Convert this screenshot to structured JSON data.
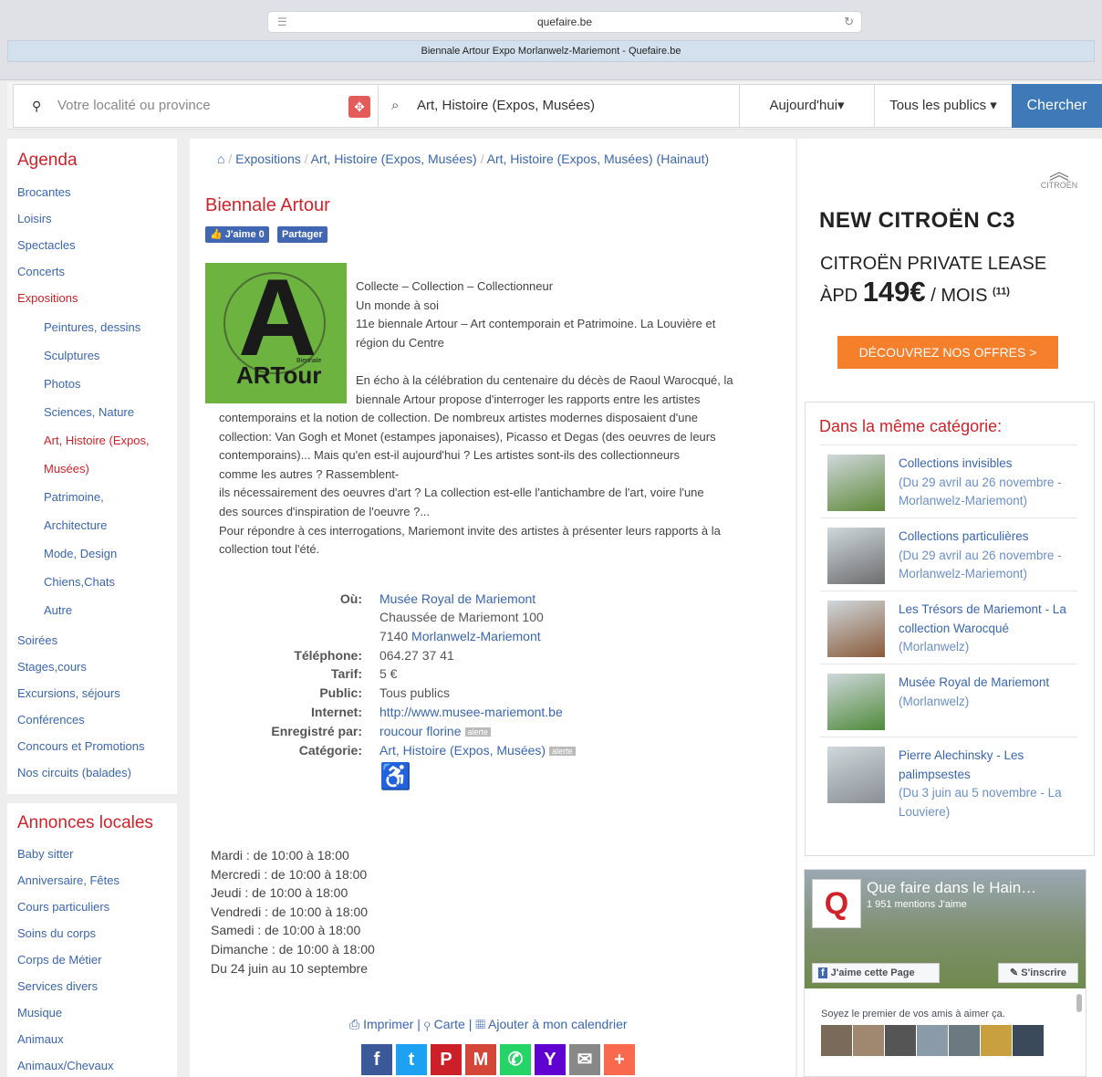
{
  "browser": {
    "url": "quefaire.be",
    "tab_title": "Biennale Artour Expo Morlanwelz-Mariemont - Quefaire.be"
  },
  "searchbar": {
    "location_placeholder": "Votre localité ou province",
    "category_value": "Art, Histoire (Expos, Musées)",
    "when_value": "Aujourd'hui▾",
    "public_value": "Tous les publics ▾",
    "search_label": "Chercher"
  },
  "sidebar": {
    "agenda_heading": "Agenda",
    "agenda_items": [
      "Brocantes",
      "Loisirs",
      "Spectacles",
      "Concerts",
      "Expositions",
      "Peintures, dessins",
      "Sculptures",
      "Photos",
      "Sciences, Nature",
      "Art, Histoire (Expos,",
      "Musées)",
      "Patrimoine,",
      "Architecture",
      "Mode, Design",
      "Chiens,Chats",
      "Autre",
      "Soirées",
      "Stages,cours",
      "Excursions, séjours",
      "Conférences",
      "Concours et Promotions",
      "Nos circuits (balades)"
    ],
    "annonces_heading": "Annonces locales",
    "annonces_items": [
      "Baby sitter",
      "Anniversaire, Fêtes",
      "Cours particuliers",
      "Soins du corps",
      "Corps de Métier",
      "Services divers",
      "Musique",
      "Animaux",
      "Animaux/Chevaux"
    ]
  },
  "breadcrumb": [
    "Expositions",
    "Art, Histoire (Expos, Musées)",
    "Art, Histoire (Expos, Musées) (Hainaut)"
  ],
  "event": {
    "title": "Biennale Artour",
    "like_label": "J'aime 0",
    "share_label": "Partager",
    "poster_text": "ARTour",
    "poster_small": "Biennale",
    "body_lines": [
      "Collecte – Collection – Collectionneur",
      "Un monde à soi",
      "11e biennale Artour – Art contemporain et Patrimoine. La Louvière et",
      "région du Centre",
      "",
      "En écho à la célébration du centenaire du décès de Raoul Warocqué, la",
      "biennale Artour propose d'interroger les rapports entre les artistes"
    ],
    "body_wide_lines": [
      "contemporains et la notion de collection. De nombreux artistes modernes disposaient d'une",
      "collection: Van Gogh et Monet (estampes japonaises), Picasso et Degas (des oeuvres de leurs",
      "contemporains)... Mais qu'en est-il aujourd'hui ? Les artistes sont-ils des collectionneurs",
      "comme les autres ? Rassemblent-",
      "ils nécessairement des oeuvres d'art ? La collection est-elle l'antichambre de l'art, voire l'une",
      "des sources d'inspiration de l'oeuvre ?...",
      "Pour répondre à ces interrogations, Mariemont invite des artistes à présenter leurs rapports à la",
      "collection tout l'été."
    ],
    "info": {
      "ou_label": "Où:",
      "ou_venue": "Musée Royal de Mariemont",
      "ou_street": "Chaussée de Mariemont 100",
      "ou_zip": "7140",
      "ou_city": "Morlanwelz-Mariemont",
      "tel_label": "Téléphone:",
      "tel": "064.27 37 41",
      "tarif_label": "Tarif:",
      "tarif": "5 €",
      "public_label": "Public:",
      "public": "Tous publics",
      "internet_label": "Internet:",
      "internet": "http://www.musee-mariemont.be",
      "by_label": "Enregistré par:",
      "by": "roucour florine",
      "alert1": "alerte",
      "cat_label": "Catégorie:",
      "cat": "Art, Histoire (Expos, Musées)",
      "alert2": "alerte"
    },
    "hours": [
      "Mardi : de 10:00 à 18:00",
      "Mercredi : de 10:00 à 18:00",
      "Jeudi : de 10:00 à 18:00",
      "Vendredi : de 10:00 à 18:00",
      "Samedi : de 10:00 à 18:00",
      "Dimanche : de 10:00 à 18:00",
      "Du 24 juin au 10 septembre"
    ],
    "actions": {
      "print": "Imprimer",
      "map": "Carte",
      "calendar": "Ajouter à mon calendrier"
    }
  },
  "share_icons": [
    {
      "name": "facebook",
      "glyph": "f",
      "color": "#3b5998"
    },
    {
      "name": "twitter",
      "glyph": "t",
      "color": "#1da1f2"
    },
    {
      "name": "pinterest",
      "glyph": "P",
      "color": "#cb2027"
    },
    {
      "name": "gmail",
      "glyph": "M",
      "color": "#d44638"
    },
    {
      "name": "whatsapp",
      "glyph": "✆",
      "color": "#25d366"
    },
    {
      "name": "yahoo",
      "glyph": "Y",
      "color": "#5f01d1"
    },
    {
      "name": "email",
      "glyph": "✉",
      "color": "#888888"
    },
    {
      "name": "addthis",
      "glyph": "+",
      "color": "#f8694d"
    }
  ],
  "ad": {
    "brand": "CITROËN",
    "line1": "NEW CITROËN C3",
    "line2": "CITROËN PRIVATE LEASE",
    "prefix": "ÀPD",
    "price": "149€",
    "per": "/ MOIS",
    "note": "(11)",
    "cta": "DÉCOUVREZ NOS OFFRES  >"
  },
  "same_category": {
    "heading": "Dans la même catégorie:",
    "items": [
      {
        "title": "Collections invisibles",
        "meta": "(Du 29 avril au 26 novembre - Morlanwelz-Mariemont)",
        "color": "#5f8a3a"
      },
      {
        "title": "Collections particulières",
        "meta": "(Du 29 avril au 26 novembre - Morlanwelz-Mariemont)",
        "color": "#6d6d6d"
      },
      {
        "title": "Les Trésors de Mariemont - La collection Warocqué",
        "meta": "(Morlanwelz)",
        "color": "#8a5a3a"
      },
      {
        "title": "Musée Royal de Mariemont",
        "meta": "(Morlanwelz)",
        "color": "#4f8a3a"
      },
      {
        "title": "Pierre Alechinsky - Les palimpsestes",
        "meta": "(Du 3 juin au 5 novembre - La Louviere)",
        "color": "#8a8f94"
      }
    ]
  },
  "facebook_widget": {
    "page_name": "Que faire dans le Hain…",
    "likes": "1 951 mentions J'aime",
    "like_btn": "J'aime cette Page",
    "subscribe_btn": "S'inscrire",
    "friends_text": "Soyez le premier de vos amis à aimer ça.",
    "logo_letter": "Q"
  }
}
